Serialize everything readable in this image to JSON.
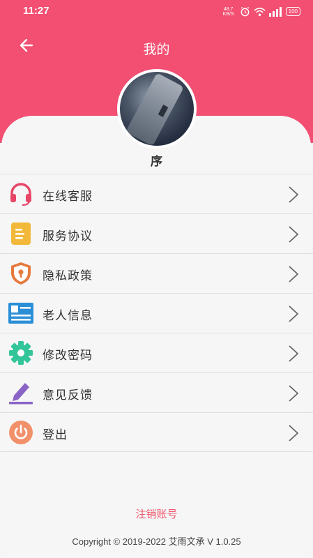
{
  "status_bar": {
    "time": "11:27",
    "net_speed_value": "48.7",
    "net_speed_unit": "KB/S",
    "battery": "100"
  },
  "header": {
    "title": "我的",
    "bg_color": "#f24f72"
  },
  "profile": {
    "name": "序"
  },
  "menu": {
    "items": [
      {
        "label": "在线客服",
        "icon": "headset-icon",
        "color": "#e84667"
      },
      {
        "label": "服务协议",
        "icon": "document-icon",
        "color": "#f1b83a"
      },
      {
        "label": "隐私政策",
        "icon": "shield-lock-icon",
        "color": "#e57a3e"
      },
      {
        "label": "老人信息",
        "icon": "id-card-icon",
        "color": "#2b8fd8"
      },
      {
        "label": "修改密码",
        "icon": "gear-icon",
        "color": "#33c59a"
      },
      {
        "label": "意见反馈",
        "icon": "pen-icon",
        "color": "#8a63c7"
      },
      {
        "label": "登出",
        "icon": "power-icon",
        "color": "#f2906a"
      }
    ]
  },
  "footer": {
    "cancel_account": "注销账号",
    "copyright": "Copyright © 2019-2022 艾雨文承 V 1.0.25"
  }
}
